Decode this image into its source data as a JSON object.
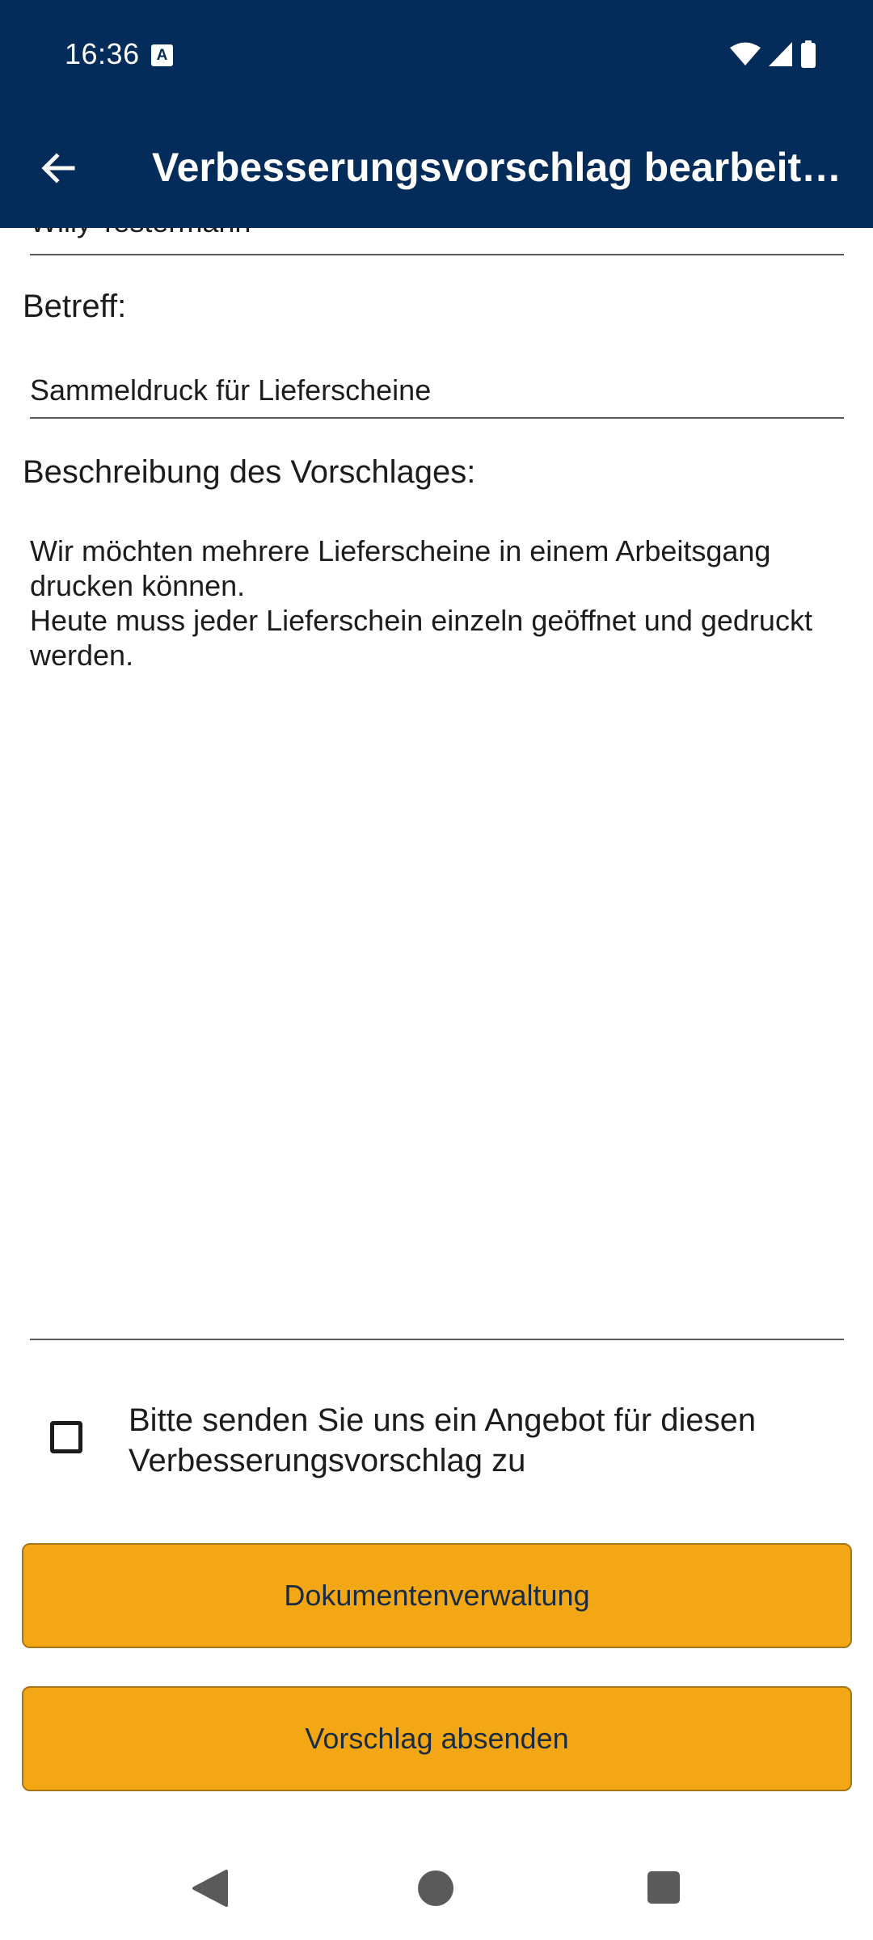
{
  "status_bar": {
    "time": "16:36",
    "notification_icon": "a-icon",
    "icons": [
      "wifi-icon",
      "signal-icon",
      "battery-icon"
    ]
  },
  "app_bar": {
    "title": "Verbesserungsvorschlag bearbeiten",
    "back_icon": "arrow-left-icon"
  },
  "form": {
    "name_value": "Willy Testermann",
    "subject_label": "Betreff:",
    "subject_value": "Sammeldruck für Lieferscheine",
    "description_label": "Beschreibung des Vorschlages:",
    "description_value": "Wir möchten mehrere Lieferscheine in einem Arbeitsgang drucken können.\nHeute muss jeder Lieferschein einzeln geöffnet und gedruckt werden.",
    "offer_checkbox_label": "Bitte senden Sie uns ein Angebot für diesen Verbesserungsvorschlag zu",
    "offer_checked": false
  },
  "buttons": {
    "documents_label": "Dokumentenverwaltung",
    "send_label": "Vorschlag absenden"
  },
  "nav_bar": {
    "icons": [
      "nav-back-icon",
      "nav-home-icon",
      "nav-recents-icon"
    ]
  },
  "colors": {
    "app_bar": "#032c5a",
    "button": "#f3a714"
  }
}
